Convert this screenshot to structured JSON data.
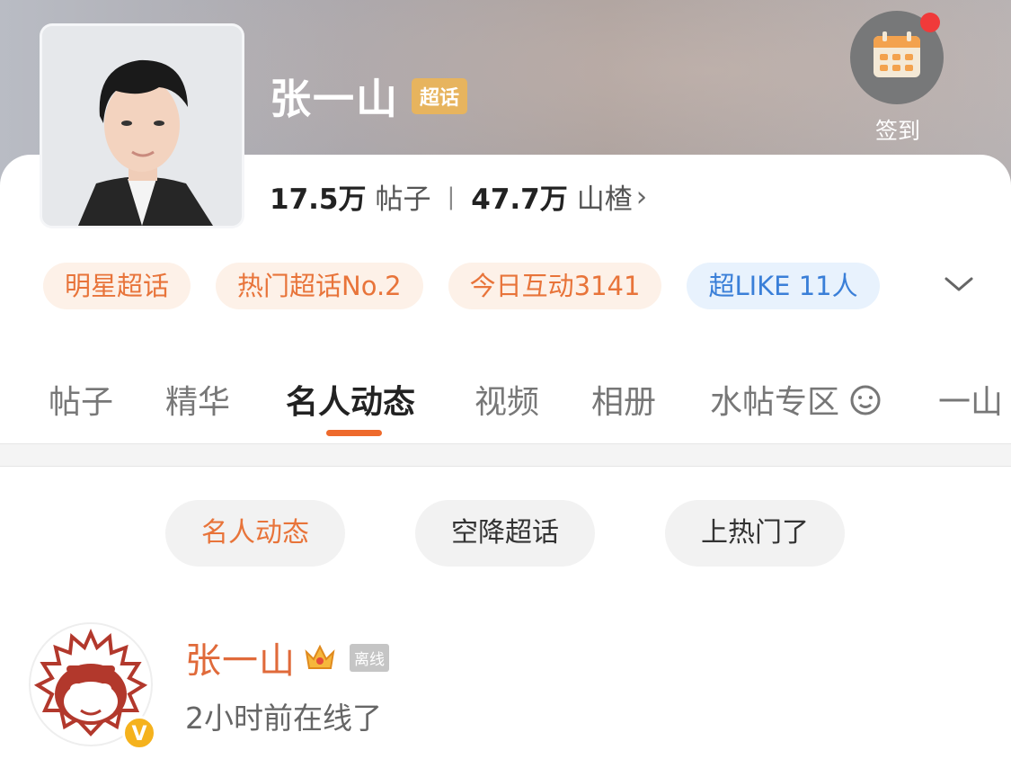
{
  "header": {
    "title": "张一山",
    "badge": "超话",
    "checkin_label": "签到",
    "checkin_icon": "calendar-icon"
  },
  "stats": {
    "posts_count": "17.5万",
    "posts_unit": "帖子",
    "fans_count": "47.7万",
    "fans_unit": "山楂",
    "chevron": "›"
  },
  "tags": [
    {
      "label": "明星超话",
      "style": "orange"
    },
    {
      "label": "热门超话No.2",
      "style": "orange"
    },
    {
      "label": "今日互动3141",
      "style": "orange"
    },
    {
      "label": "超LIKE 11人",
      "style": "blue"
    }
  ],
  "tabs": [
    "帖子",
    "精华",
    "名人动态",
    "视频",
    "相册",
    "水帖专区",
    "一山"
  ],
  "active_tab": "名人动态",
  "filters": [
    {
      "label": "名人动态",
      "active": true
    },
    {
      "label": "空降超话",
      "active": false
    },
    {
      "label": "上热门了",
      "active": false
    }
  ],
  "post": {
    "author": "张一山",
    "offline_label": "离线",
    "status": "2小时前在线了",
    "verified_mark": "V"
  },
  "colors": {
    "accent": "#ee6a2c",
    "tag_orange_bg": "#fdf1e8",
    "tag_blue_bg": "#e8f2fd",
    "verified": "#f5b21d"
  }
}
